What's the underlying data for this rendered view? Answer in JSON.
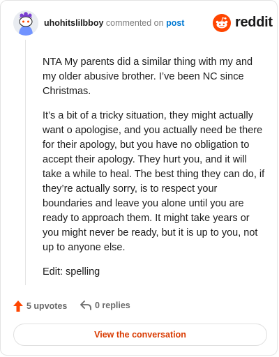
{
  "comment": {
    "username": "uhohitslilbboy",
    "action_text": "commented on",
    "post_link_label": "post",
    "paragraphs": [
      "NTA My parents did a similar thing with my and my older abusive brother. I’ve been NC since Christmas.",
      "It’s a bit of a tricky situation, they might actually want o apologise, and you actually need be there for their apology, but you have no obligation to accept their apology. They hurt you, and it will take a while to heal. The best thing they can do, if they’re actually sorry, is to respect your boundaries and leave you alone until you are ready to approach them. It might take years or you might never be ready, but it is up to you, not up to anyone else.",
      "Edit: spelling"
    ]
  },
  "brand": {
    "name": "reddit",
    "icon": "reddit-logo-icon",
    "color": "#ff4500"
  },
  "stats": {
    "upvotes": "5 upvotes",
    "replies": "0 replies"
  },
  "cta": {
    "label": "View the conversation"
  },
  "colors": {
    "accent": "#d93a00",
    "link": "#0079d3",
    "upvote": "#ff4500"
  }
}
